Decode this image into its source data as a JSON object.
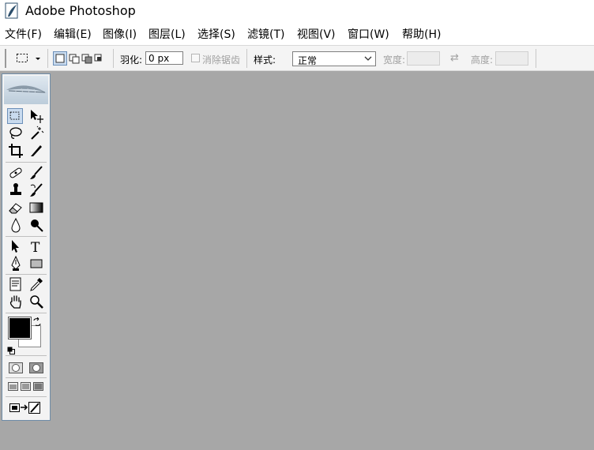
{
  "window": {
    "title": "Adobe Photoshop"
  },
  "menubar": {
    "items": [
      {
        "label": "文件(F)"
      },
      {
        "label": "编辑(E)"
      },
      {
        "label": "图像(I)"
      },
      {
        "label": "图层(L)"
      },
      {
        "label": "选择(S)"
      },
      {
        "label": "滤镜(T)"
      },
      {
        "label": "视图(V)"
      },
      {
        "label": "窗口(W)"
      },
      {
        "label": "帮助(H)"
      }
    ]
  },
  "options": {
    "feather_label": "羽化:",
    "feather_value": "0 px",
    "antialias_label": "消除锯齿",
    "style_label": "样式:",
    "style_value": "正常",
    "width_label": "宽度:",
    "height_label": "高度:"
  },
  "colors": {
    "foreground": "#000000",
    "background": "#ffffff",
    "canvas": "#a7a7a7"
  },
  "icons": [
    "photoshop-app-icon",
    "rectangular-marquee-icon",
    "move-icon",
    "lasso-icon",
    "magic-wand-icon",
    "crop-icon",
    "slice-icon",
    "healing-brush-icon",
    "brush-icon",
    "clone-stamp-icon",
    "history-brush-icon",
    "eraser-icon",
    "gradient-icon",
    "blur-icon",
    "dodge-icon",
    "path-selection-icon",
    "type-icon",
    "pen-icon",
    "shape-icon",
    "notes-icon",
    "eyedropper-icon",
    "hand-icon",
    "zoom-icon",
    "swap-colors-icon",
    "default-colors-icon",
    "standard-mode-icon",
    "quick-mask-icon",
    "screen-mode-icon",
    "jump-to-imageready-icon"
  ]
}
